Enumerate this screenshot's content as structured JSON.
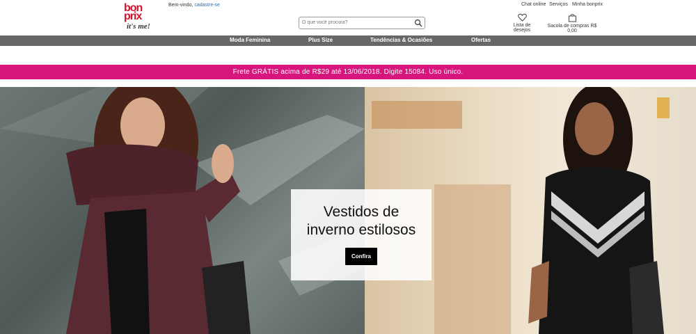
{
  "brand": {
    "line1": "bon",
    "line2": "prix",
    "tagline": "it's me!",
    "color": "#d3132b"
  },
  "header": {
    "welcome": "Bem-vindo,",
    "signup_link": "cadastre-se",
    "search_placeholder": "O que você procura?",
    "top_links": [
      "Chat online",
      "Serviços",
      "Minha bonprix"
    ],
    "wishlist_label": "Lista de desejos",
    "cart_label": "Sacola de compras R$ 0,00"
  },
  "nav": {
    "background": "#676767",
    "items": [
      "Moda Feminina",
      "Plus Size",
      "Tendências & Ocasiões",
      "Ofertas"
    ]
  },
  "promo": {
    "text": "Frete GRÁTIS acima de R$29 até 13/06/2018. Digite 15084. Uso único.",
    "color": "#d7167d"
  },
  "hero": {
    "title_line1": "Vestidos de",
    "title_line2": "inverno estilosos",
    "cta_label": "Confira"
  },
  "icons": [
    "search-icon",
    "heart-icon",
    "shopping-bag-icon"
  ]
}
